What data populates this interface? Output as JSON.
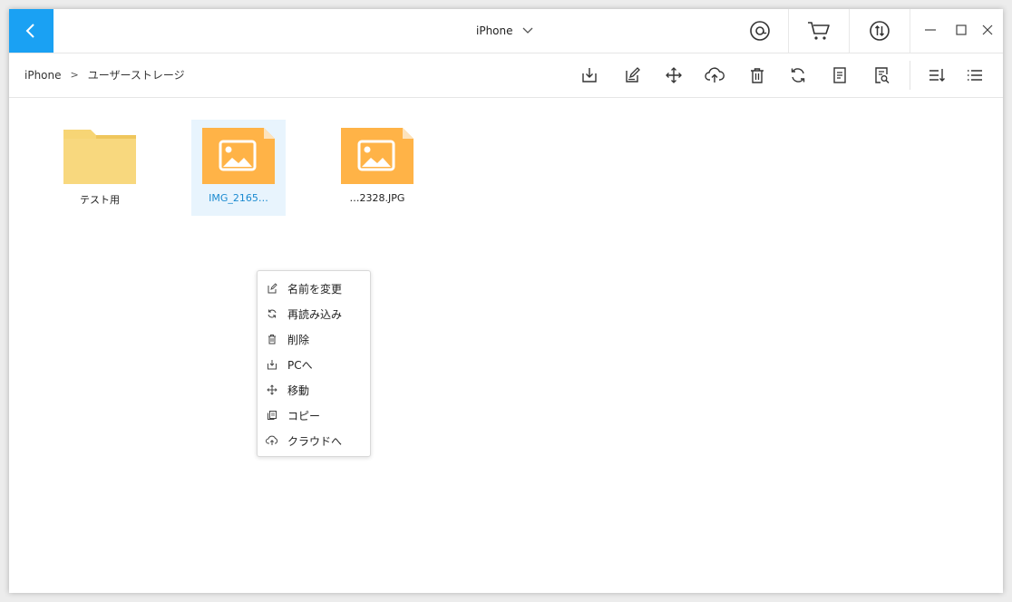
{
  "titlebar": {
    "device_name": "iPhone",
    "icons": [
      "chevron-left-icon",
      "chevron-down-icon",
      "at-sign-icon",
      "cart-icon",
      "transfer-icon",
      "minimize-icon",
      "maximize-icon",
      "close-icon"
    ],
    "accent_color": "#1aa1f3"
  },
  "breadcrumb": {
    "items": [
      "iPhone",
      "ユーザーストレージ"
    ],
    "separator": ">"
  },
  "toolbar": {
    "icons": [
      "export-icon",
      "edit-icon",
      "move-icon",
      "upload-cloud-icon",
      "trash-icon",
      "refresh-icon",
      "document-icon",
      "search-document-icon",
      "sort-icon",
      "list-view-icon"
    ]
  },
  "files": [
    {
      "name": "テスト用",
      "type": "folder",
      "icon": "folder-icon",
      "color": "#f7d575"
    },
    {
      "name": "IMG_2165…",
      "type": "image",
      "icon": "image-file-icon",
      "color": "#ffb347",
      "selected": true
    },
    {
      "name": "…2328.JPG",
      "type": "image",
      "icon": "image-file-icon",
      "color": "#ffb347"
    }
  ],
  "context_menu": {
    "items": [
      {
        "label": "名前を変更",
        "icon": "edit-icon"
      },
      {
        "label": "再読み込み",
        "icon": "refresh-icon"
      },
      {
        "label": "削除",
        "icon": "trash-icon"
      },
      {
        "label": "PCへ",
        "icon": "export-icon"
      },
      {
        "label": "移動",
        "icon": "move-icon"
      },
      {
        "label": "コピー",
        "icon": "copy-icon"
      },
      {
        "label": "クラウドへ",
        "icon": "upload-cloud-icon"
      }
    ]
  }
}
